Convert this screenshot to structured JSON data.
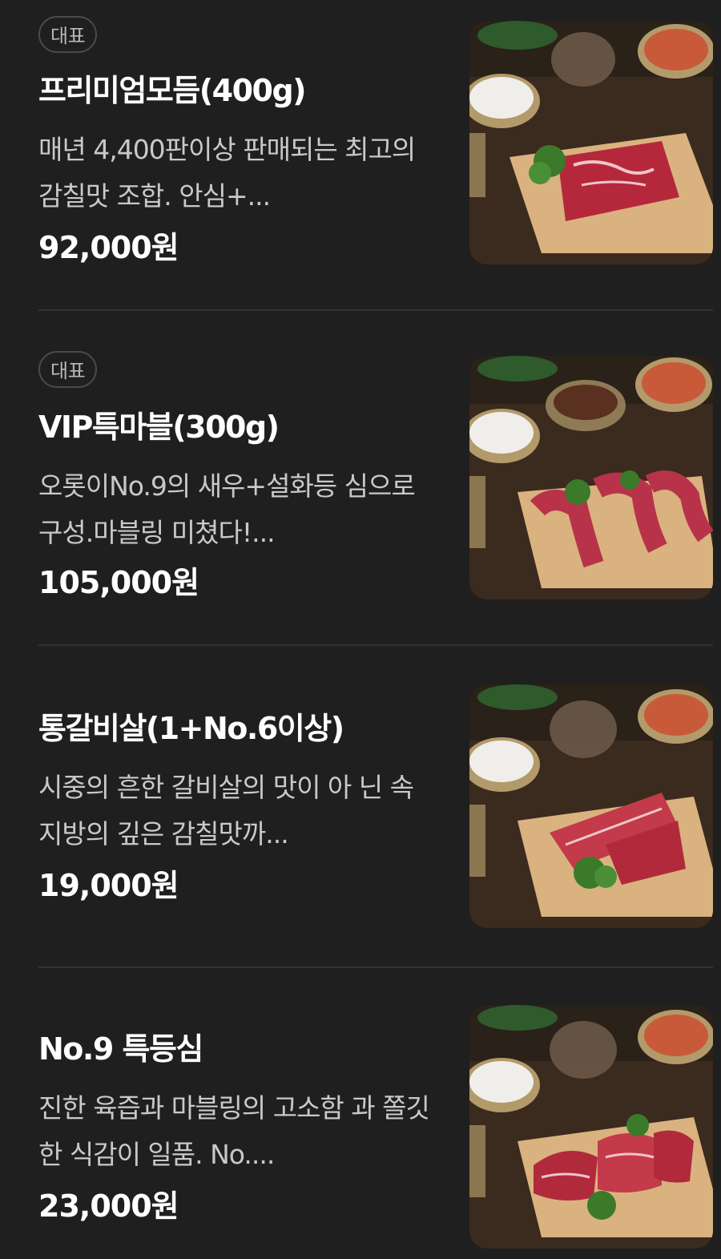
{
  "menu": {
    "items": [
      {
        "badge": "대표",
        "title": "프리미엄모듬(400g)",
        "description": "매년 4,400판이상 판매되는 최고의 감칠맛 조합. 안심+...",
        "price": "92,000원",
        "photo_icon": "meat-platter-photo"
      },
      {
        "badge": "대표",
        "title": "VIP특마블(300g)",
        "description": "오롯이No.9의 새우+설화등 심으로 구성.마블링 미쳤다!...",
        "price": "105,000원",
        "photo_icon": "meat-platter-photo"
      },
      {
        "badge": "",
        "title": "통갈비살(1+No.6이상)",
        "description": "시중의 흔한 갈비살의 맛이 아 닌 속지방의 깊은 감칠맛까...",
        "price": "19,000원",
        "photo_icon": "meat-platter-photo"
      },
      {
        "badge": "",
        "title": "No.9 특등심",
        "description": "진한 육즙과 마블링의 고소함 과 쫄깃한 식감이 일품. No....",
        "price": "23,000원",
        "photo_icon": "meat-platter-photo"
      }
    ]
  },
  "colors": {
    "background": "#1f1f1f",
    "divider": "#333333",
    "badge_border": "#4a4a4a",
    "text_primary": "#ffffff",
    "text_secondary": "#c9c9c9"
  }
}
